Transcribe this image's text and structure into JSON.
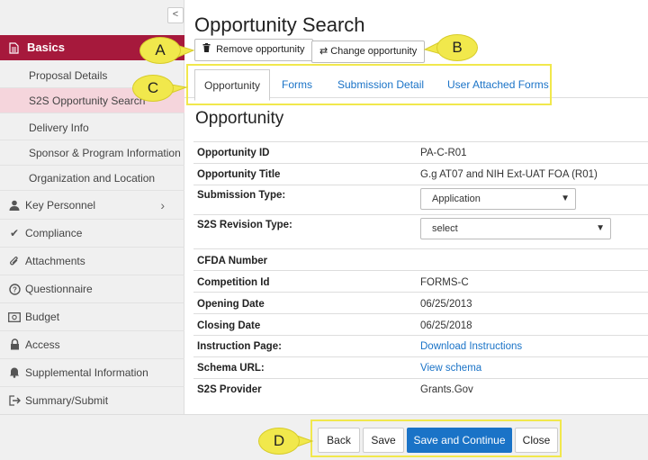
{
  "sidebar": {
    "collapse_glyph": "<",
    "active": {
      "label": "Basics",
      "icon": "document-icon"
    },
    "subitems": [
      {
        "label": "Proposal Details"
      },
      {
        "label": "S2S Opportunity Search"
      },
      {
        "label": "Delivery Info"
      },
      {
        "label": "Sponsor & Program Information"
      },
      {
        "label": "Organization and Location"
      }
    ],
    "items": [
      {
        "label": "Key Personnel",
        "icon": "person-icon"
      },
      {
        "label": "Compliance",
        "icon": "check-icon"
      },
      {
        "label": "Attachments",
        "icon": "paperclip-icon"
      },
      {
        "label": "Questionnaire",
        "icon": "question-icon"
      },
      {
        "label": "Budget",
        "icon": "money-icon"
      },
      {
        "label": "Access",
        "icon": "lock-icon"
      },
      {
        "label": "Supplemental Information",
        "icon": "bell-icon"
      },
      {
        "label": "Summary/Submit",
        "icon": "exit-icon"
      }
    ]
  },
  "main": {
    "title": "Opportunity Search",
    "remove_label": "Remove opportunity",
    "change_label": "Change opportunity",
    "tabs": [
      {
        "label": "Opportunity"
      },
      {
        "label": "Forms"
      },
      {
        "label": "Submission Detail"
      },
      {
        "label": "User Attached Forms"
      }
    ],
    "section_title": "Opportunity",
    "fields": {
      "opportunity_id": {
        "label": "Opportunity ID",
        "value": "PA-C-R01"
      },
      "opportunity_title": {
        "label": "Opportunity Title",
        "value": "G.g AT07 and NIH Ext-UAT FOA (R01)"
      },
      "submission_type": {
        "label": "Submission Type:",
        "value": "Application"
      },
      "revision_type": {
        "label": "S2S Revision Type:",
        "value": "select"
      },
      "cfda": {
        "label": "CFDA Number",
        "value": ""
      },
      "competition_id": {
        "label": "Competition Id",
        "value": "FORMS-C"
      },
      "opening_date": {
        "label": "Opening Date",
        "value": "06/25/2013"
      },
      "closing_date": {
        "label": "Closing Date",
        "value": "06/25/2018"
      },
      "instruction_page": {
        "label": "Instruction Page:",
        "value": "Download Instructions"
      },
      "schema_url": {
        "label": "Schema URL:",
        "value": "View schema"
      },
      "s2s_provider": {
        "label": "S2S Provider",
        "value": "Grants.Gov"
      }
    }
  },
  "footer": {
    "back": "Back",
    "save": "Save",
    "save_continue": "Save and Continue",
    "close": "Close"
  },
  "callouts": {
    "a": "A",
    "b": "B",
    "c": "C",
    "d": "D"
  },
  "colors": {
    "accent": "#a6193c",
    "selected_sub": "#f5d5dc",
    "link": "#1a73c7",
    "highlight": "#f1e84c"
  }
}
